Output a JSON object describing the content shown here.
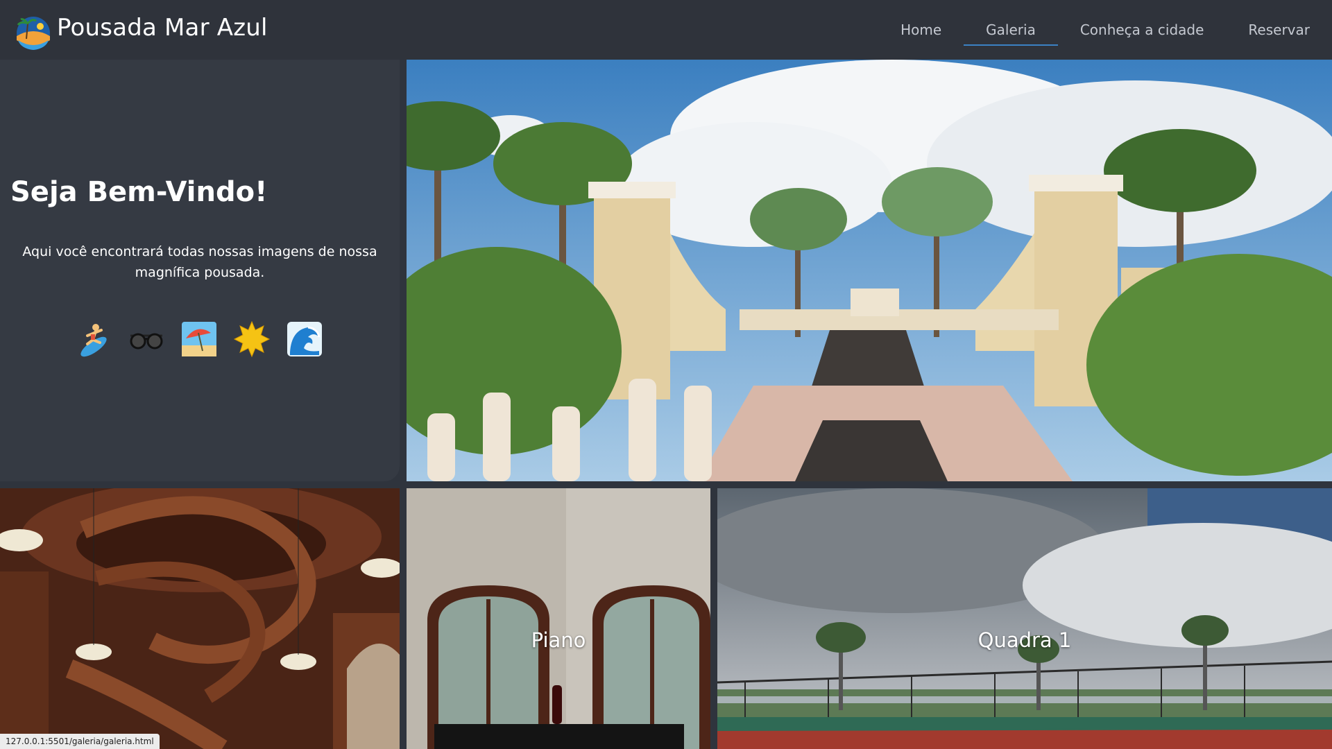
{
  "header": {
    "brand": "Pousada Mar Azul",
    "nav": [
      {
        "label": "Home",
        "active": false
      },
      {
        "label": "Galeria",
        "active": true
      },
      {
        "label": "Conheça a cidade",
        "active": false
      },
      {
        "label": "Reservar",
        "active": false
      }
    ]
  },
  "welcome": {
    "title": "Seja Bem-Vindo!",
    "text": "Aqui você encontrará todas nossas imagens de nossa magnífica pousada.",
    "emojis": [
      "surfer-icon",
      "sunglasses-icon",
      "beach-umbrella-icon",
      "sun-icon",
      "wave-icon"
    ]
  },
  "gallery": {
    "piano_label": "Piano",
    "court_label": "Quadra 1"
  },
  "status_bar": {
    "url": "127.0.0.1:5501/galeria/galeria.html"
  },
  "colors": {
    "header_bg": "#2f333b",
    "panel_bg": "#353a43",
    "nav_active_underline": "#3b82c4",
    "nav_text": "#c5c9d1"
  }
}
